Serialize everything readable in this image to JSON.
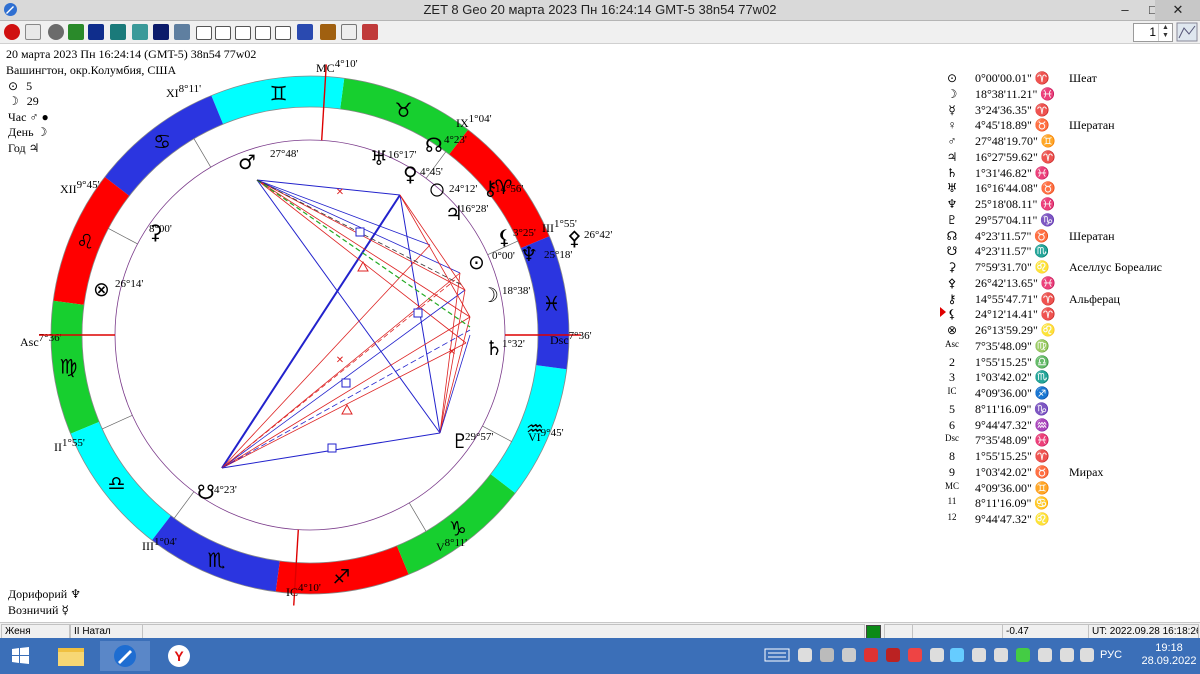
{
  "window": {
    "title": "ZET 8 Geo    20 марта 2023   Пн   16:24:14 GMT-5 38n54   77w02",
    "btn_min": "–",
    "btn_max": "□",
    "btn_close": "✕"
  },
  "toolbar": {
    "spin_value": "1"
  },
  "header": {
    "line1": "20 марта 2023   Пн   16:24:14 (GMT-5)  38n54   77w02",
    "line2": "Вашингтон, окр.Колумбия, США"
  },
  "rulers": [
    {
      "glyph": "⊙",
      "value": "5"
    },
    {
      "glyph": "☽",
      "value": "29"
    },
    {
      "label": "Час",
      "glyph": "♂ ●"
    },
    {
      "label": "День",
      "glyph": "☽"
    },
    {
      "label": "Год",
      "glyph": "♃"
    }
  ],
  "footer": [
    {
      "label": "Дорифорий",
      "glyph": "♆"
    },
    {
      "label": "Возничий",
      "glyph": "☿"
    }
  ],
  "chart": {
    "cusps": [
      {
        "name": "MC",
        "deg": "4°10'"
      },
      {
        "name": "XI",
        "deg": "8°11'"
      },
      {
        "name": "XII",
        "deg": "9°45'"
      },
      {
        "name": "Asc",
        "deg": "7°36'"
      },
      {
        "name": "II",
        "deg": "1°55'"
      },
      {
        "name": "III",
        "deg": "1°04'"
      },
      {
        "name": "IC",
        "deg": "4°10'"
      },
      {
        "name": "V",
        "deg": "8°11'"
      },
      {
        "name": "VI",
        "deg": "9°45'"
      },
      {
        "name": "Dsc",
        "deg": "7°36'"
      },
      {
        "name": "III",
        "deg": "1°55'"
      },
      {
        "name": "IX",
        "deg": "1°04'"
      }
    ],
    "planets": [
      {
        "glyph": "♂",
        "deg": "27°48'"
      },
      {
        "glyph": "♅",
        "deg": "16°17'"
      },
      {
        "glyph": "☊",
        "deg": "4°23'"
      },
      {
        "glyph": "♀",
        "deg": "4°45'"
      },
      {
        "glyph": "",
        "deg": "24°12'"
      },
      {
        "glyph": "⚷",
        "deg": "14°56'"
      },
      {
        "glyph": "♃",
        "deg": "16°28'"
      },
      {
        "glyph": "⚸",
        "deg": "3°25'"
      },
      {
        "glyph": "⊙",
        "deg": "0°00'"
      },
      {
        "glyph": "♆",
        "deg": "25°18'"
      },
      {
        "glyph": "☽",
        "deg": "18°38'"
      },
      {
        "glyph": "♄",
        "deg": "1°32'"
      },
      {
        "glyph": "♇",
        "deg": "29°57'"
      },
      {
        "glyph": "☋",
        "deg": "4°23'"
      },
      {
        "glyph": "⚳",
        "deg": "8°00'"
      },
      {
        "glyph": "⊗",
        "deg": "26°14'"
      },
      {
        "glyph": "⚴",
        "deg": "26°42'"
      }
    ],
    "signs": [
      "♈",
      "♉",
      "♊",
      "♋",
      "♌",
      "♍",
      "♎",
      "♏",
      "♐",
      "♑",
      "♒",
      "♓"
    ]
  },
  "positions": [
    {
      "glyph": "⊙",
      "value": "0°00'00.01\" ♈",
      "star": "Шеат"
    },
    {
      "glyph": "☽",
      "value": "18°38'11.21\" ♓",
      "star": ""
    },
    {
      "glyph": "☿",
      "value": "3°24'36.35\" ♈",
      "star": ""
    },
    {
      "glyph": "♀",
      "value": "4°45'18.89\" ♉",
      "star": "Шератан"
    },
    {
      "glyph": "♂",
      "value": "27°48'19.70\" ♊",
      "star": ""
    },
    {
      "glyph": "♃",
      "value": "16°27'59.62\" ♈",
      "star": ""
    },
    {
      "glyph": "♄",
      "value": "1°31'46.82\" ♓",
      "star": ""
    },
    {
      "glyph": "♅",
      "value": "16°16'44.08\" ♉",
      "star": ""
    },
    {
      "glyph": "♆",
      "value": "25°18'08.11\" ♓",
      "star": ""
    },
    {
      "glyph": "♇",
      "value": "29°57'04.11\" ♑",
      "star": ""
    },
    {
      "glyph": "☊",
      "value": "4°23'11.57\" ♉",
      "star": "Шератан"
    },
    {
      "glyph": "☋",
      "value": "4°23'11.57\" ♏",
      "star": ""
    },
    {
      "glyph": "⚳",
      "value": "7°59'31.70\" ♌",
      "star": "Аселлус Бореалис"
    },
    {
      "glyph": "⚴",
      "value": "26°42'13.65\" ♓",
      "star": ""
    },
    {
      "glyph": "⚷",
      "value": "14°55'47.71\" ♈",
      "star": "Альферац"
    },
    {
      "glyph": "⚸",
      "value": "24°12'14.41\" ♈",
      "star": ""
    },
    {
      "glyph": "⊗",
      "value": "26°13'59.29\" ♌",
      "star": ""
    },
    {
      "glyph": "Asc",
      "value": "7°35'48.09\" ♍",
      "star": ""
    },
    {
      "glyph": "2",
      "value": "1°55'15.25\" ♎",
      "star": ""
    },
    {
      "glyph": "3",
      "value": "1°03'42.02\" ♏",
      "star": ""
    },
    {
      "glyph": "IC",
      "value": "4°09'36.00\" ♐",
      "star": ""
    },
    {
      "glyph": "5",
      "value": "8°11'16.09\" ♑",
      "star": ""
    },
    {
      "glyph": "6",
      "value": "9°44'47.32\" ♒",
      "star": ""
    },
    {
      "glyph": "Dsc",
      "value": "7°35'48.09\" ♓",
      "star": ""
    },
    {
      "glyph": "8",
      "value": "1°55'15.25\" ♈",
      "star": ""
    },
    {
      "glyph": "9",
      "value": "1°03'42.02\" ♉",
      "star": "Мирах"
    },
    {
      "glyph": "MC",
      "value": "4°09'36.00\" ♊",
      "star": ""
    },
    {
      "glyph": "11",
      "value": "8°11'16.09\" ♋",
      "star": ""
    },
    {
      "glyph": "12",
      "value": "9°44'47.32\" ♌",
      "star": ""
    }
  ],
  "status": {
    "name": "Женя",
    "chart": "II Натал",
    "value": "-0.47",
    "ut": "UT: 2022.09.28 16:18:26"
  },
  "taskbar": {
    "lang": "РУС",
    "time": "19:18",
    "date": "28.09.2022"
  },
  "colors": {
    "fire": "#ff0000",
    "earth": "#17cf2f",
    "air": "#00ffff",
    "water": "#2b35e0"
  }
}
